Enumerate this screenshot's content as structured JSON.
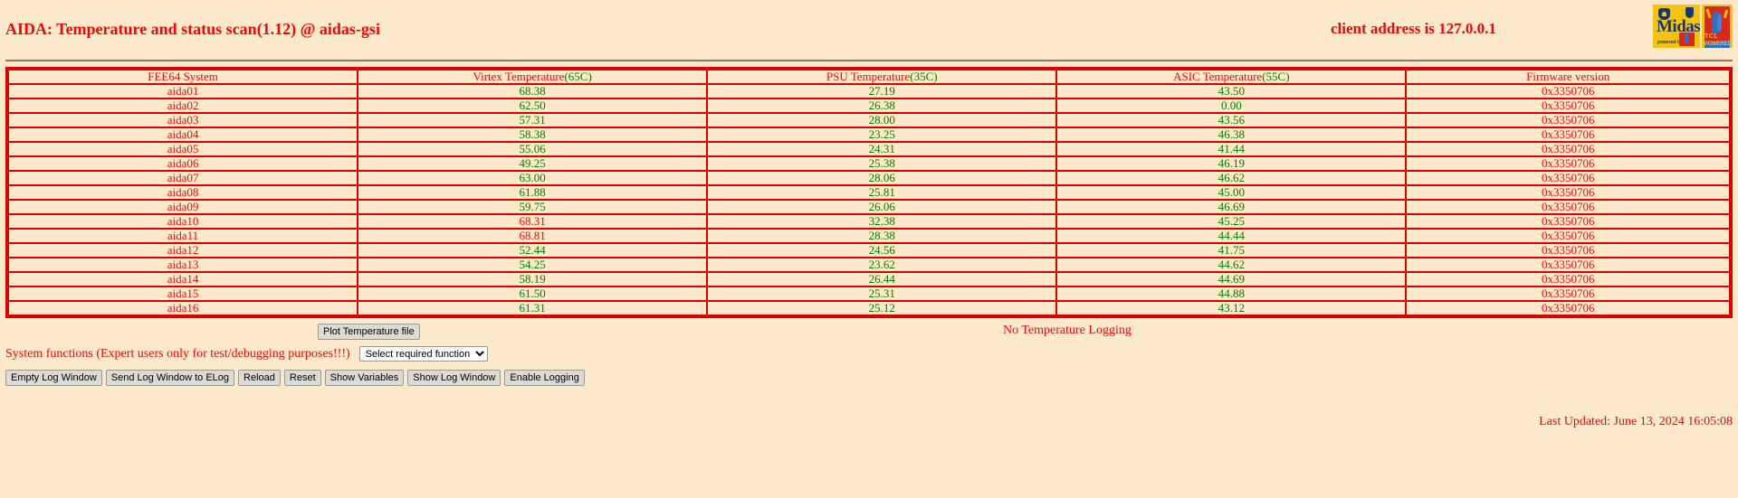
{
  "header": {
    "title": "AIDA: Temperature and status scan(1.12) @ aidas-gsi",
    "client_address": "client address is 127.0.0.1",
    "logo_midas_word": "Midas",
    "logo_midas_sub": "powered by",
    "logo_tcl_text": "TCL",
    "logo_tcl_powered": "POWERED"
  },
  "table": {
    "headers": [
      {
        "name": "FEE64 System",
        "limit": ""
      },
      {
        "name": "Virtex Temperature",
        "limit": "(65C)"
      },
      {
        "name": "PSU Temperature",
        "limit": "(35C)"
      },
      {
        "name": "ASIC Temperature",
        "limit": "(55C)"
      },
      {
        "name": "Firmware version",
        "limit": ""
      }
    ],
    "rows": [
      {
        "system": "aida01",
        "virtex": "68.38",
        "virtex_color": "green",
        "psu": "27.19",
        "psu_color": "green",
        "asic": "43.50",
        "asic_color": "green",
        "firmware": "0x3350706"
      },
      {
        "system": "aida02",
        "virtex": "62.50",
        "virtex_color": "green",
        "psu": "26.38",
        "psu_color": "green",
        "asic": "0.00",
        "asic_color": "green",
        "firmware": "0x3350706"
      },
      {
        "system": "aida03",
        "virtex": "57.31",
        "virtex_color": "green",
        "psu": "28.00",
        "psu_color": "green",
        "asic": "43.56",
        "asic_color": "green",
        "firmware": "0x3350706"
      },
      {
        "system": "aida04",
        "virtex": "58.38",
        "virtex_color": "green",
        "psu": "23.25",
        "psu_color": "green",
        "asic": "46.38",
        "asic_color": "green",
        "firmware": "0x3350706"
      },
      {
        "system": "aida05",
        "virtex": "55.06",
        "virtex_color": "green",
        "psu": "24.31",
        "psu_color": "green",
        "asic": "41.44",
        "asic_color": "green",
        "firmware": "0x3350706"
      },
      {
        "system": "aida06",
        "virtex": "49.25",
        "virtex_color": "green",
        "psu": "25.38",
        "psu_color": "green",
        "asic": "46.19",
        "asic_color": "green",
        "firmware": "0x3350706"
      },
      {
        "system": "aida07",
        "virtex": "63.00",
        "virtex_color": "green",
        "psu": "28.06",
        "psu_color": "green",
        "asic": "46.62",
        "asic_color": "green",
        "firmware": "0x3350706"
      },
      {
        "system": "aida08",
        "virtex": "61.88",
        "virtex_color": "green",
        "psu": "25.81",
        "psu_color": "green",
        "asic": "45.00",
        "asic_color": "green",
        "firmware": "0x3350706"
      },
      {
        "system": "aida09",
        "virtex": "59.75",
        "virtex_color": "green",
        "psu": "26.06",
        "psu_color": "green",
        "asic": "46.69",
        "asic_color": "green",
        "firmware": "0x3350706"
      },
      {
        "system": "aida10",
        "virtex": "68.31",
        "virtex_color": "red",
        "psu": "32.38",
        "psu_color": "green",
        "asic": "45.25",
        "asic_color": "green",
        "firmware": "0x3350706"
      },
      {
        "system": "aida11",
        "virtex": "68.81",
        "virtex_color": "red",
        "psu": "28.38",
        "psu_color": "green",
        "asic": "44.44",
        "asic_color": "green",
        "firmware": "0x3350706"
      },
      {
        "system": "aida12",
        "virtex": "52.44",
        "virtex_color": "green",
        "psu": "24.56",
        "psu_color": "green",
        "asic": "41.75",
        "asic_color": "green",
        "firmware": "0x3350706"
      },
      {
        "system": "aida13",
        "virtex": "54.25",
        "virtex_color": "green",
        "psu": "23.62",
        "psu_color": "green",
        "asic": "44.62",
        "asic_color": "green",
        "firmware": "0x3350706"
      },
      {
        "system": "aida14",
        "virtex": "58.19",
        "virtex_color": "green",
        "psu": "26.44",
        "psu_color": "green",
        "asic": "44.69",
        "asic_color": "green",
        "firmware": "0x3350706"
      },
      {
        "system": "aida15",
        "virtex": "61.50",
        "virtex_color": "green",
        "psu": "25.31",
        "psu_color": "green",
        "asic": "44.88",
        "asic_color": "green",
        "firmware": "0x3350706"
      },
      {
        "system": "aida16",
        "virtex": "61.31",
        "virtex_color": "green",
        "psu": "25.12",
        "psu_color": "green",
        "asic": "43.12",
        "asic_color": "green",
        "firmware": "0x3350706"
      }
    ]
  },
  "controls": {
    "plot_button": "Plot Temperature file",
    "logging_status": "No Temperature Logging",
    "system_functions_label": "System functions (Expert users only for test/debugging purposes!!!)",
    "function_select_value": "Select required function",
    "function_select_options": [
      "Select required function"
    ],
    "buttons": [
      "Empty Log Window",
      "Send Log Window to ELog",
      "Reload",
      "Reset",
      "Show Variables",
      "Show Log Window",
      "Enable Logging"
    ]
  },
  "footer": {
    "last_updated": "Last Updated: June 13, 2024 16:05:08"
  },
  "colors": {
    "background": "#fce9cb",
    "text_red": "#f40606",
    "text_green": "#008000",
    "border_red": "#dd0000"
  }
}
